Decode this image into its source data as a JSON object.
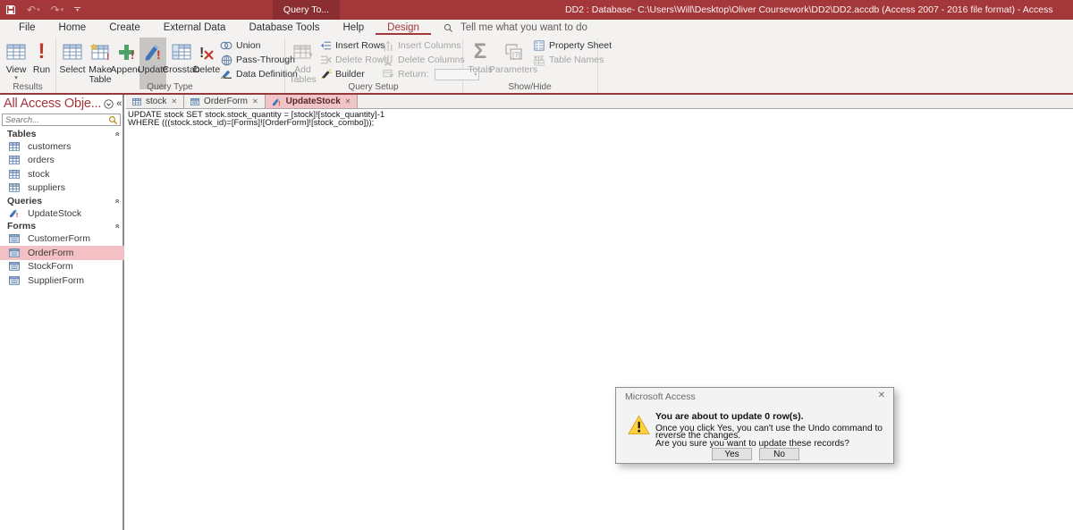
{
  "titlebar": {
    "contextual_tab": "Query To...",
    "title": "DD2 : Database- C:\\Users\\Will\\Desktop\\Oliver Coursework\\DD2\\DD2.accdb (Access 2007 - 2016 file format)  -  Access"
  },
  "menubar": {
    "tabs": [
      "File",
      "Home",
      "Create",
      "External Data",
      "Database Tools",
      "Help",
      "Design"
    ],
    "active_tab": "Design",
    "tell_me": "Tell me what you want to do"
  },
  "ribbon": {
    "results": {
      "label": "Results",
      "view": "View",
      "run": "Run"
    },
    "query_type": {
      "label": "Query Type",
      "select": "Select",
      "make_table": "Make Table",
      "append": "Append",
      "update": "Update",
      "crosstab": "Crosstab",
      "del": "Delete",
      "union": "Union",
      "pass_through": "Pass-Through",
      "data_definition": "Data Definition"
    },
    "query_setup": {
      "label": "Query Setup",
      "add_tables": "Add Tables",
      "insert_rows": "Insert Rows",
      "delete_rows": "Delete Rows",
      "builder": "Builder",
      "insert_columns": "Insert Columns",
      "delete_columns": "Delete Columns",
      "return_label": "Return:"
    },
    "show_hide": {
      "label": "Show/Hide",
      "totals": "Totals",
      "parameters": "Parameters",
      "property_sheet": "Property Sheet",
      "table_names": "Table Names"
    }
  },
  "sidebar": {
    "title": "All Access Obje...",
    "search_placeholder": "Search...",
    "groups": [
      {
        "name": "Tables",
        "items": [
          "customers",
          "orders",
          "stock",
          "suppliers"
        ]
      },
      {
        "name": "Queries",
        "items": [
          "UpdateStock"
        ]
      },
      {
        "name": "Forms",
        "items": [
          "CustomerForm",
          "OrderForm",
          "StockForm",
          "SupplierForm"
        ]
      }
    ],
    "selected_item": "OrderForm"
  },
  "doc_tabs": [
    "stock",
    "OrderForm",
    "UpdateStock"
  ],
  "active_doc_tab": "UpdateStock",
  "sql": {
    "line1": "UPDATE stock SET stock.stock_quantity = [stock]![stock_quantity]-1",
    "line2": "WHERE (((stock.stock_id)=[Forms]![OrderForm]![stock_combo]));"
  },
  "dialog": {
    "title": "Microsoft Access",
    "heading": "You are about to update 0 row(s).",
    "body_line1": "Once you click Yes, you can't use the Undo command to reverse the changes.",
    "body_line2": "Are you sure you want to update these records?",
    "yes_label": "Yes",
    "no_label": "No"
  },
  "icons": {
    "caret_down": "▾",
    "close": "✕",
    "collapse_chevrons": "«",
    "group_collapse": "»",
    "undo": "↶",
    "redo": "↷"
  },
  "colors": {
    "accent": "#a4373a",
    "contextual_tab_bg": "#8b2e31",
    "selection_pink": "#f3c1c4",
    "pressed_gray": "#c8c6c4",
    "warning_yellow": "#ffd23b"
  }
}
